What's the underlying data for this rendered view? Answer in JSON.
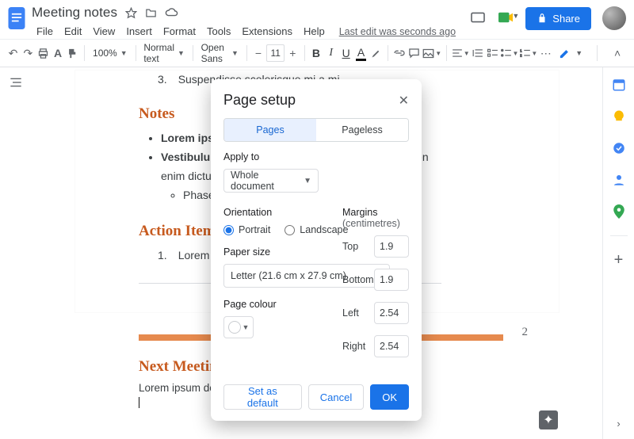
{
  "doc": {
    "title": "Meeting notes"
  },
  "menus": {
    "file": "File",
    "edit": "Edit",
    "view": "View",
    "insert": "Insert",
    "format": "Format",
    "tools": "Tools",
    "extensions": "Extensions",
    "help": "Help"
  },
  "lastEdit": "Last edit was seconds ago",
  "share": {
    "label": "Share"
  },
  "toolbar": {
    "zoom": "100%",
    "styles": "Normal text",
    "font": "Open Sans",
    "fontSize": "11"
  },
  "document": {
    "ordered3": "Suspendisse scelerisque mi a mi.",
    "notes_heading": "Notes",
    "bullet1": "Lorem ipsum",
    "bullet2_strong": "Vestibulum a",
    "bullet2_tail_a": "sapien",
    "bullet2_line2": "enim dictum q",
    "sub1": "Phasell",
    "action_heading": "Action Items",
    "oli1": "Lorem ipsum",
    "page2_number": "2",
    "next_meeting_heading": "Next Meeting Ag",
    "body1": "Lorem ipsum dolor sit amet, consectetuer adipiscing elit."
  },
  "dialog": {
    "title": "Page setup",
    "tab_pages": "Pages",
    "tab_pageless": "Pageless",
    "apply_to_label": "Apply to",
    "apply_to_value": "Whole document",
    "orientation_label": "Orientation",
    "orientation_portrait": "Portrait",
    "orientation_landscape": "Landscape",
    "paper_size_label": "Paper size",
    "paper_size_value": "Letter (21.6 cm x 27.9 cm)",
    "page_colour_label": "Page colour",
    "margins_label": "Margins",
    "margins_unit": "(centimetres)",
    "top_label": "Top",
    "top_value": "1.9",
    "bottom_label": "Bottom",
    "bottom_value": "1.9",
    "left_label": "Left",
    "left_value": "2.54",
    "right_label": "Right",
    "right_value": "2.54",
    "set_default": "Set as default",
    "cancel": "Cancel",
    "ok": "OK"
  }
}
